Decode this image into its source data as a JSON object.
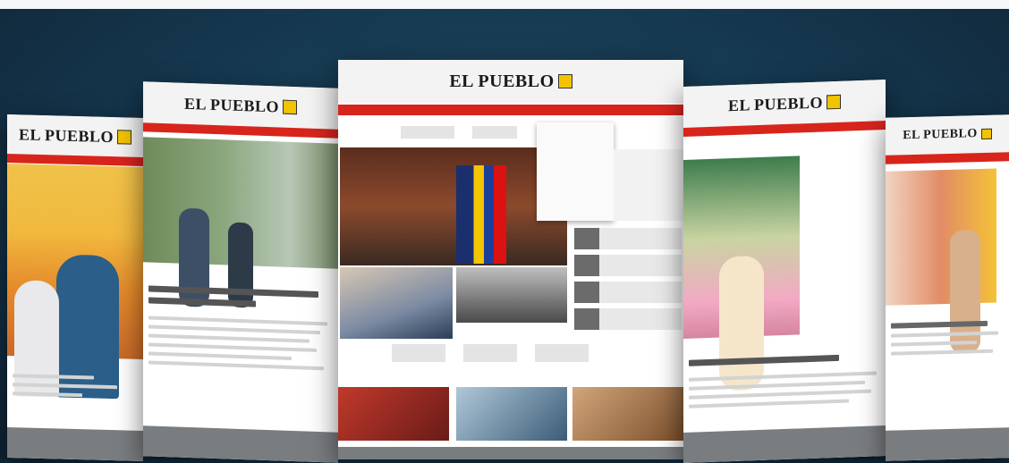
{
  "brand": {
    "name": "EL PUEBLO",
    "accent_red": "#d7251c",
    "accent_yellow": "#f2c400"
  },
  "mockups": [
    {
      "id": "far-left",
      "logo": "EL PUEBLO",
      "headline": ""
    },
    {
      "id": "left",
      "logo": "EL PUEBLO",
      "headline": ""
    },
    {
      "id": "center",
      "logo": "EL PUEBLO",
      "headline": ""
    },
    {
      "id": "right",
      "logo": "EL PUEBLO",
      "headline": ""
    },
    {
      "id": "far-right",
      "logo": "EL PUEBLO",
      "headline": ""
    }
  ]
}
